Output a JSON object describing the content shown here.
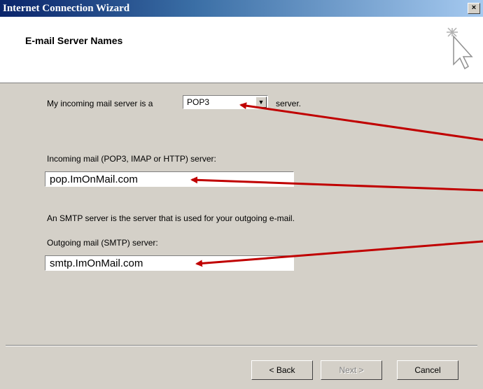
{
  "window": {
    "title": "Internet Connection Wizard",
    "close_label": "×"
  },
  "header": {
    "title": "E-mail Server Names"
  },
  "incoming_type": {
    "prefix": "My incoming mail server is a",
    "selected": "POP3",
    "suffix": "server."
  },
  "incoming_server": {
    "label": "Incoming mail (POP3, IMAP or HTTP) server:",
    "value": "pop.ImOnMail.com"
  },
  "smtp_note": "An SMTP server is the server that is used for your outgoing e-mail.",
  "outgoing_server": {
    "label": "Outgoing mail (SMTP) server:",
    "value": "smtp.ImOnMail.com"
  },
  "buttons": {
    "back": "< Back",
    "next": "Next >",
    "cancel": "Cancel"
  },
  "colors": {
    "annotation_arrow": "#c00000",
    "title_bar": "#0a246a",
    "dialog_bg": "#d4d0c8"
  }
}
